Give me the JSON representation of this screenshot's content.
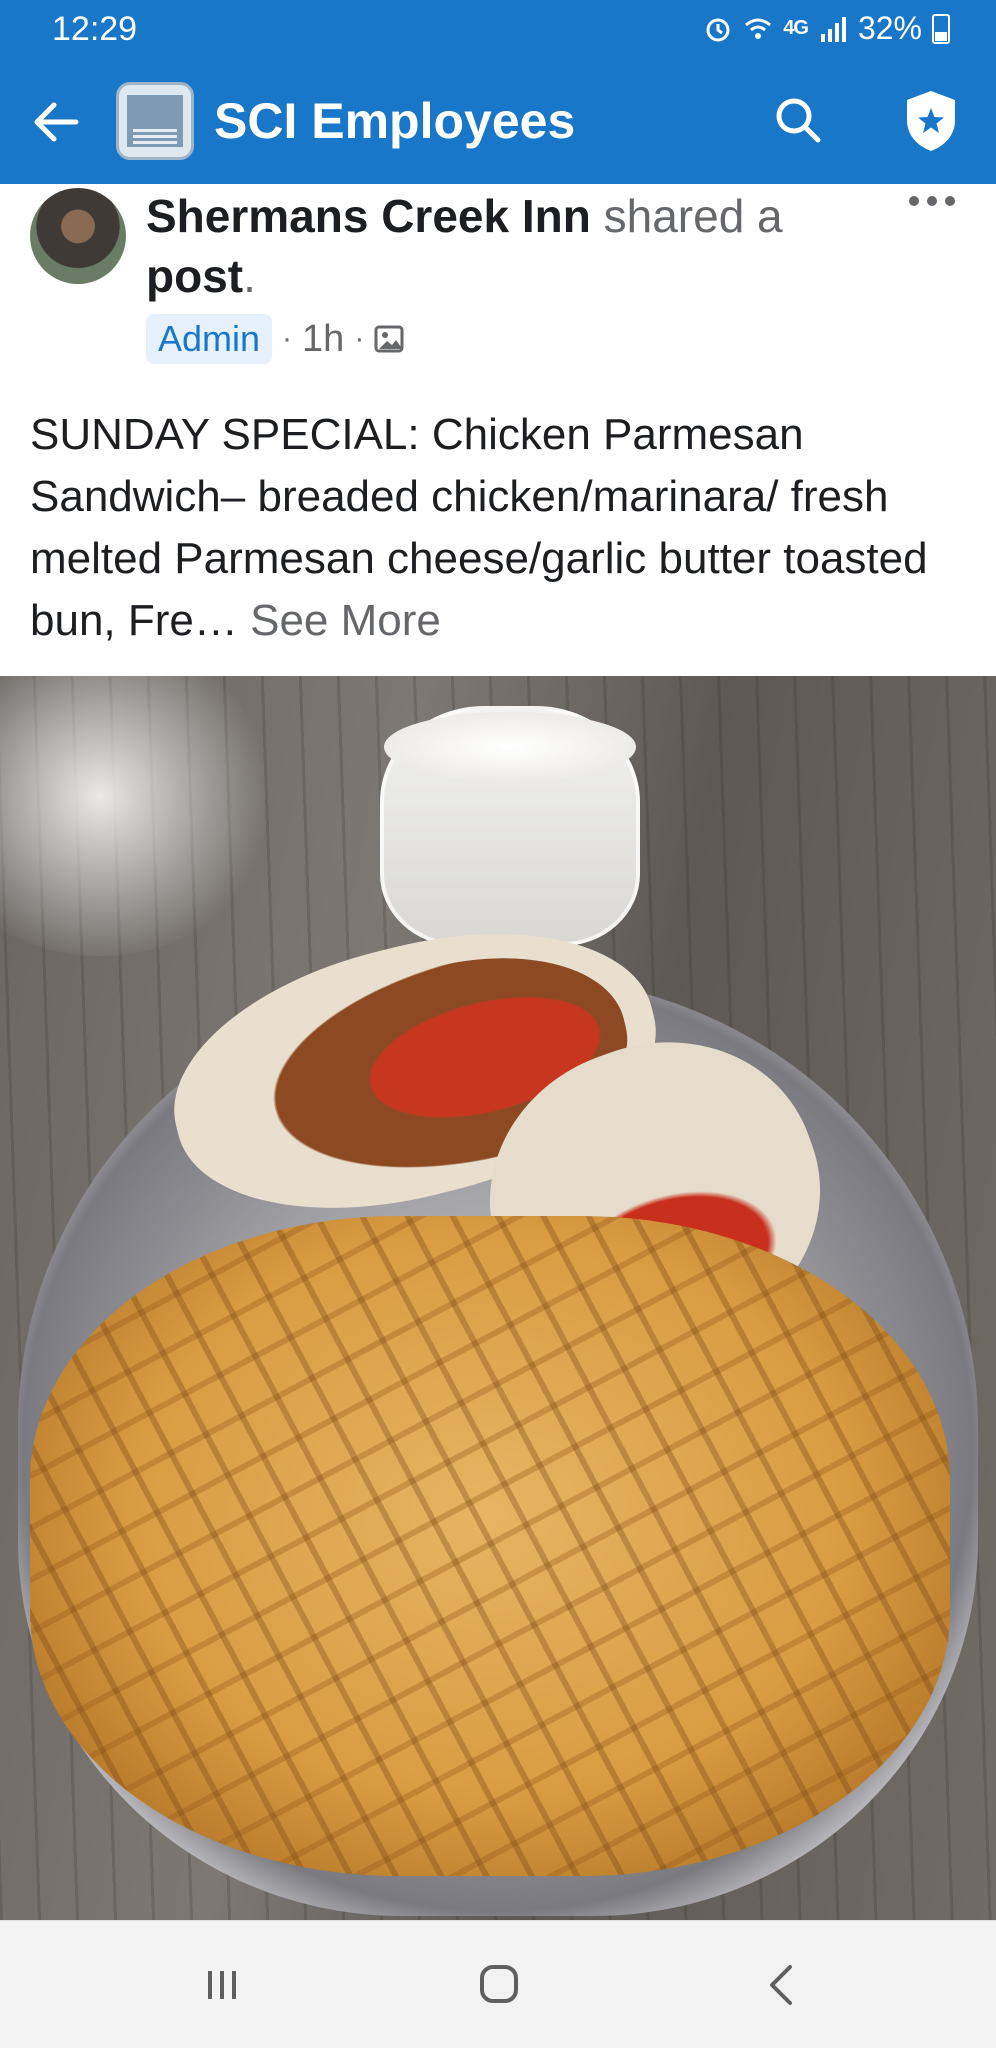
{
  "status_bar": {
    "time": "12:29",
    "network": "4G",
    "battery": "32%",
    "battery_level": 0.32
  },
  "app_bar": {
    "title": "SCI Employees"
  },
  "post": {
    "author": "Shermans Creek Inn",
    "action": "shared a",
    "action_object": "post",
    "badge": "Admin",
    "time": "1h",
    "text": "SUNDAY SPECIAL: Chicken Parmesan Sandwich– breaded chicken/marinara/ fresh melted Parmesan cheese/garlic butter toasted bun, Fre…",
    "see_more": "See More"
  },
  "icons": {
    "back": "arrow-left-icon",
    "search": "search-icon",
    "shield": "shield-star-icon",
    "more": "more-horizontal-icon",
    "audience": "photo-icon"
  },
  "colors": {
    "app_bar": "#1877c9",
    "link": "#1877c9",
    "secondary_text": "#65676b"
  }
}
